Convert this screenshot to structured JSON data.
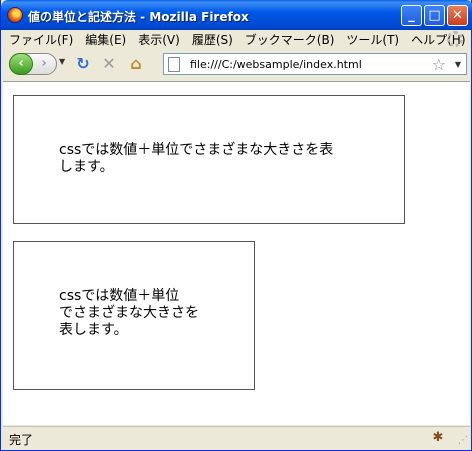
{
  "window": {
    "title": "値の単位と記述方法 - Mozilla Firefox"
  },
  "titlebar_buttons": {
    "minimize": "_",
    "maximize": "□",
    "close": "✕"
  },
  "menubar": {
    "items": [
      {
        "label": "ファイル(F)"
      },
      {
        "label": "編集(E)"
      },
      {
        "label": "表示(V)"
      },
      {
        "label": "履歴(S)"
      },
      {
        "label": "ブックマーク(B)"
      },
      {
        "label": "ツール(T)"
      },
      {
        "label": "ヘルプ(H)"
      }
    ]
  },
  "navbar": {
    "back_glyph": "‹",
    "forward_glyph": "›",
    "dropdown_glyph": "▼",
    "reload_glyph": "↻",
    "stop_glyph": "✕",
    "home_glyph": "⌂",
    "bookmark_glyph": "☆",
    "url": "file:///C:/websample/index.html"
  },
  "content": {
    "box1_lines": [
      "cssでは数値＋単位でさまざまな大きさを表",
      "します。"
    ],
    "box2_lines": [
      "cssでは数値＋単位",
      "でさまざまな大きさを",
      "表します。"
    ]
  },
  "status": {
    "text": "完了"
  },
  "colors": {
    "titlebar": "#0058e6",
    "back_button": "#3a9a1e",
    "reload": "#2a6fd6"
  }
}
